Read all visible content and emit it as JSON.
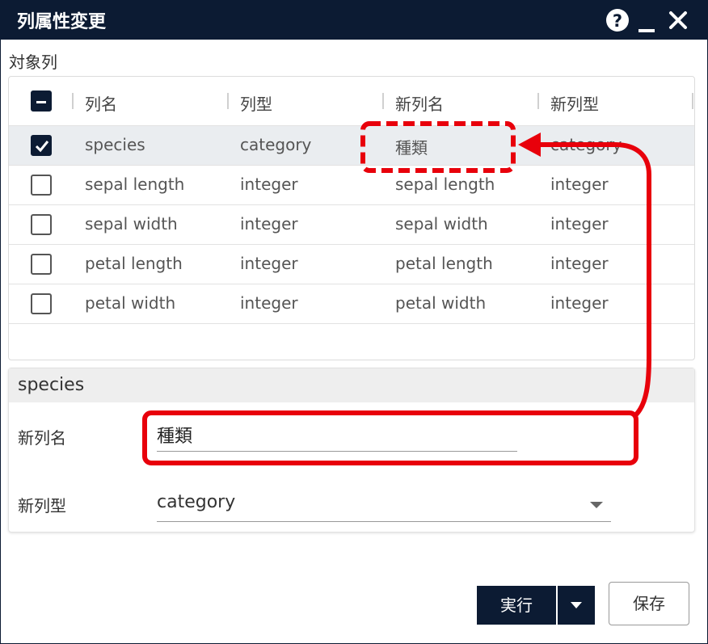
{
  "window": {
    "title": "列属性変更"
  },
  "section": {
    "label": "対象列"
  },
  "table": {
    "columns": [
      "列名",
      "列型",
      "新列名",
      "新列型"
    ],
    "rows": [
      {
        "checked": true,
        "name": "species",
        "type": "category",
        "new_name": "種類",
        "new_type": "category"
      },
      {
        "checked": false,
        "name": "sepal length",
        "type": "integer",
        "new_name": "sepal length",
        "new_type": "integer"
      },
      {
        "checked": false,
        "name": "sepal width",
        "type": "integer",
        "new_name": "sepal width",
        "new_type": "integer"
      },
      {
        "checked": false,
        "name": "petal length",
        "type": "integer",
        "new_name": "petal length",
        "new_type": "integer"
      },
      {
        "checked": false,
        "name": "petal width",
        "type": "integer",
        "new_name": "petal width",
        "new_type": "integer"
      }
    ]
  },
  "detail": {
    "title": "species",
    "new_name_label": "新列名",
    "new_name_value": "種類",
    "new_type_label": "新列型",
    "new_type_value": "category"
  },
  "buttons": {
    "run": "実行",
    "save": "保存"
  },
  "icons": {
    "help": "help-icon",
    "minimize": "minimize-icon",
    "close": "close-icon",
    "dropdown": "chevron-down-icon"
  },
  "colors": {
    "primary": "#0c1b33",
    "annotation": "#e8000b",
    "selected_row": "#eaedf0"
  }
}
